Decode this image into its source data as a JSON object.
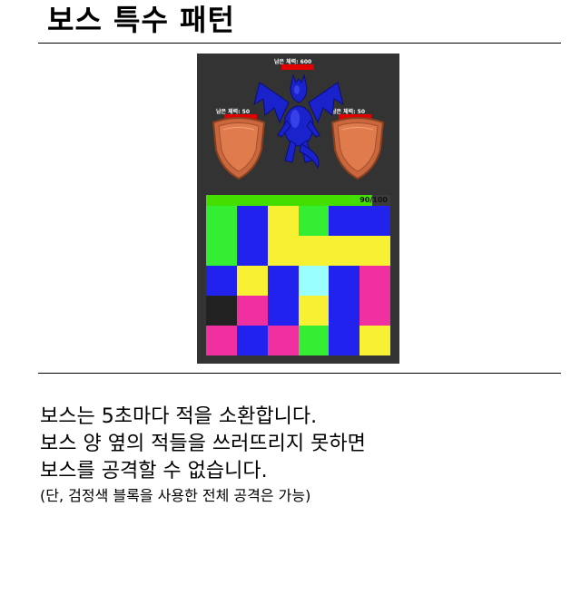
{
  "page": {
    "title": "보스 특수 패턴",
    "description_lines": [
      "보스는 5초마다 적을 소환합니다.",
      "보스 양 옆의 적들을 쓰러뜨리지 못하면",
      "보스를 공격할 수 없습니다."
    ],
    "note": "(단, 검정색 블록을 사용한 전체 공격은 가능)"
  },
  "game": {
    "boss_hp_label": "남은 체력: 600",
    "left_minion_hp_label": "남은 체력: 50",
    "right_minion_hp_label": "남은 체력: 50",
    "progress": {
      "text": "90/100",
      "fraction": 0.9
    },
    "board_colors": {
      "G": "#33ee33",
      "B": "#2222ee",
      "Y": "#f8f033",
      "C": "#99ffff",
      "P": "#f02fa0",
      "K": "#222222"
    },
    "board": [
      [
        "G",
        "B",
        "Y",
        "G",
        "B",
        "B"
      ],
      [
        "G",
        "B",
        "Y",
        "Y",
        "Y",
        "Y"
      ],
      [
        "B",
        "Y",
        "B",
        "C",
        "B",
        "P"
      ],
      [
        "K",
        "P",
        "B",
        "Y",
        "B",
        "P"
      ],
      [
        "P",
        "B",
        "P",
        "G",
        "B",
        "Y"
      ]
    ]
  }
}
